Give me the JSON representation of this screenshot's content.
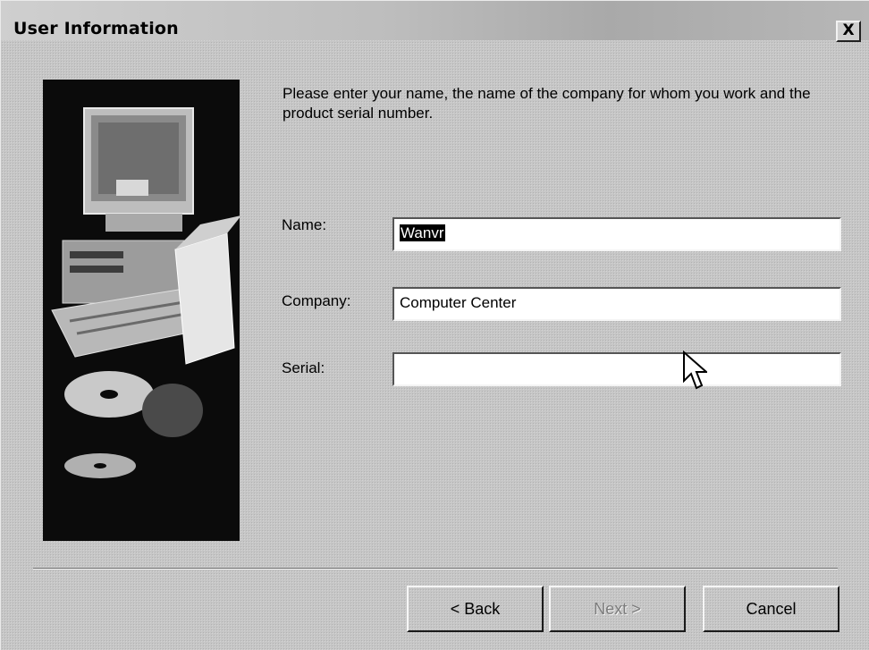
{
  "window": {
    "title": "User Information",
    "close_label": "X"
  },
  "intro_text": "Please enter your name, the name of the company for whom you work and the product serial number.",
  "form": {
    "name": {
      "label": "Name:",
      "value": "Wanvr"
    },
    "company": {
      "label": "Company:",
      "value": "Computer Center"
    },
    "serial": {
      "label": "Serial:",
      "value": ""
    }
  },
  "buttons": {
    "back": "< Back",
    "next": "Next >",
    "cancel": "Cancel"
  },
  "icons": {
    "close": "close-icon",
    "illustration": "computer-setup-illustration",
    "cursor": "mouse-pointer-icon"
  }
}
